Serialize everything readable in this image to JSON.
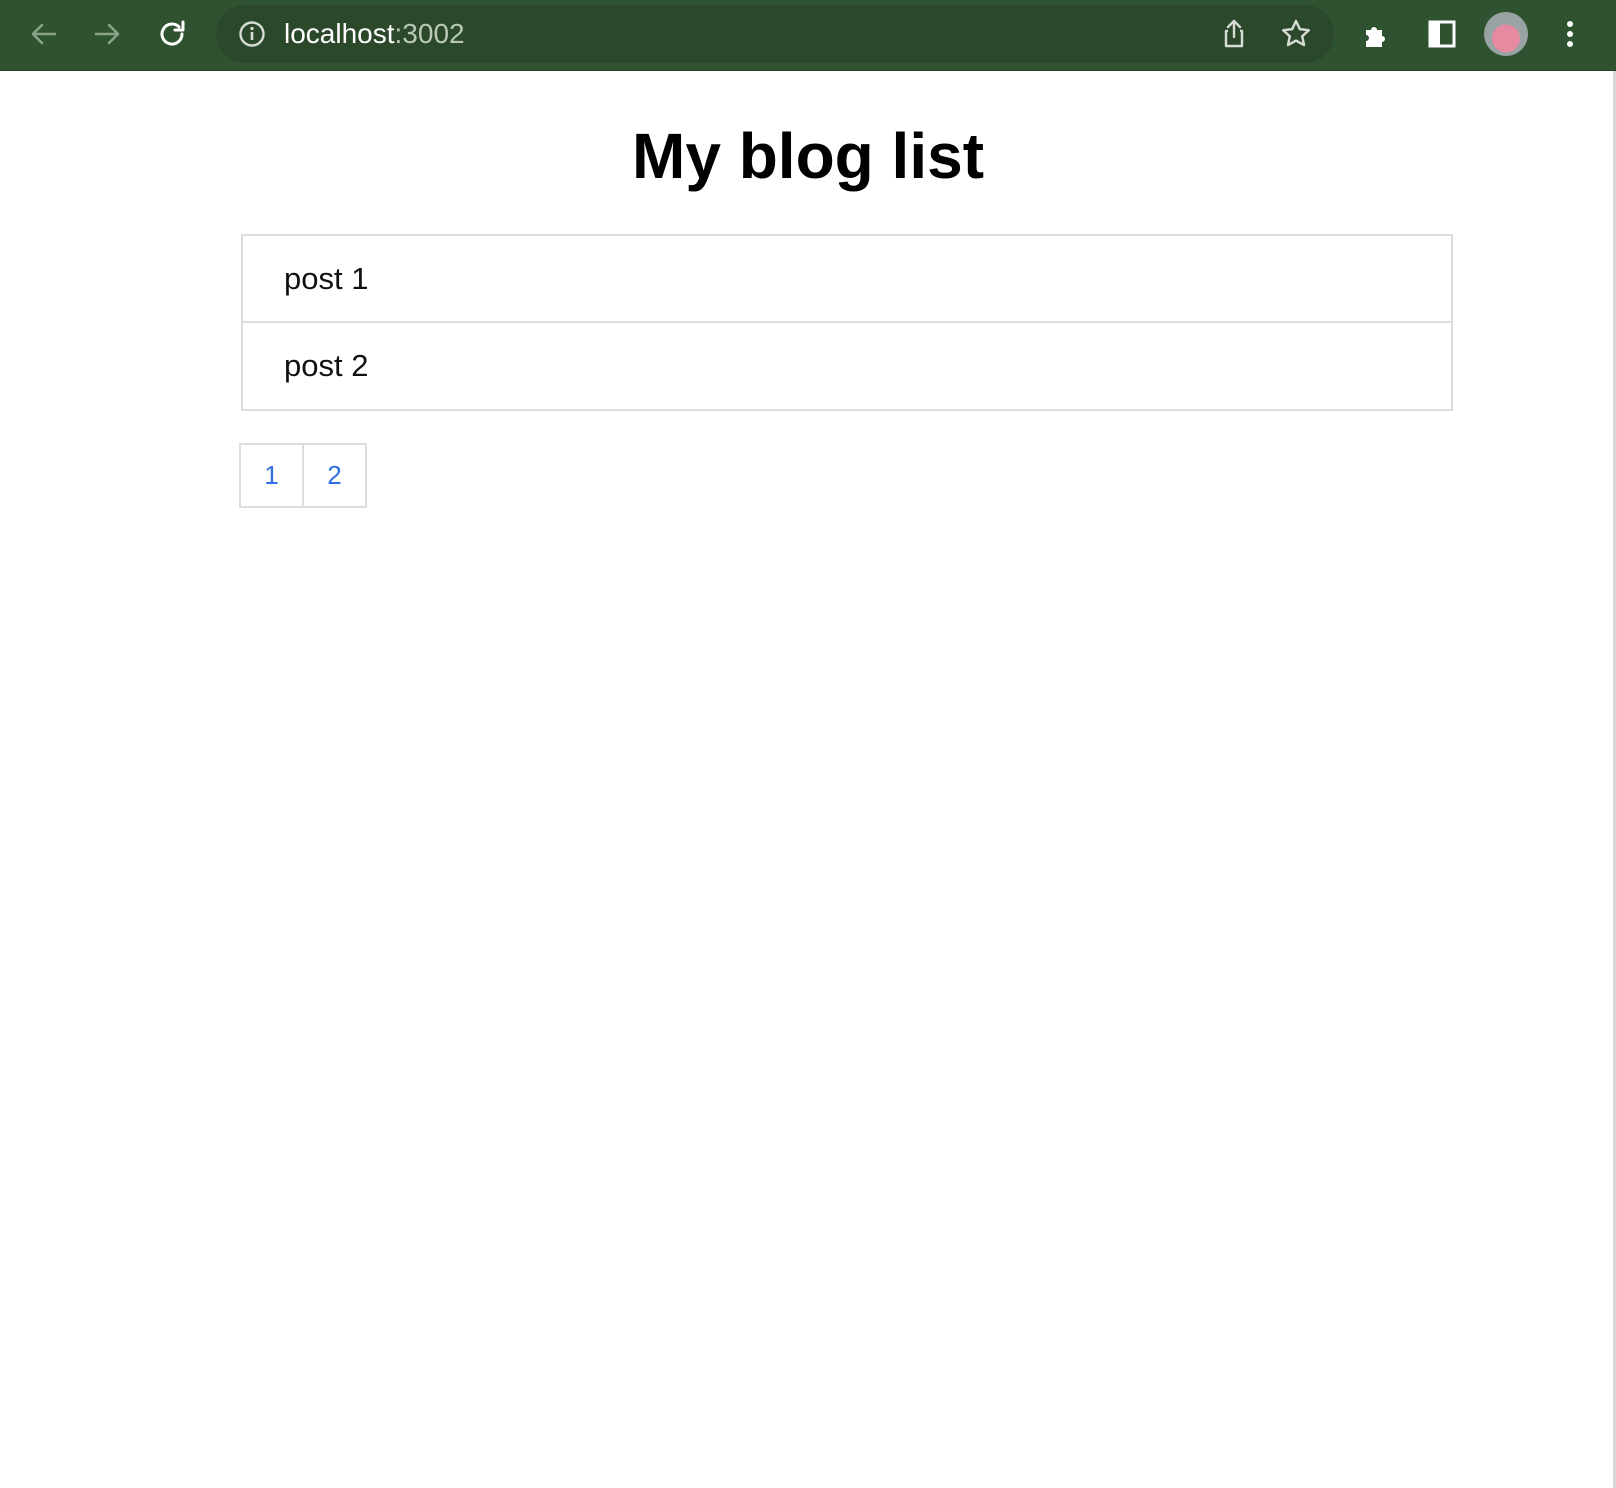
{
  "browser": {
    "url_host": "localhost",
    "url_port": ":3002",
    "icons": [
      "back-arrow-icon",
      "forward-arrow-icon",
      "reload-icon",
      "info-icon",
      "share-icon",
      "star-icon",
      "extensions-icon",
      "side-panel-icon",
      "profile-avatar",
      "kebab-menu-icon"
    ],
    "colors": {
      "toolbar": "#2f5230",
      "omnibox": "#2b482b"
    }
  },
  "page": {
    "title": "My blog list",
    "posts": [
      {
        "label": "post 1"
      },
      {
        "label": "post 2"
      }
    ],
    "pagination": [
      {
        "label": "1"
      },
      {
        "label": "2"
      }
    ],
    "colors": {
      "link": "#2f6fe0",
      "border": "#dddddd"
    }
  }
}
